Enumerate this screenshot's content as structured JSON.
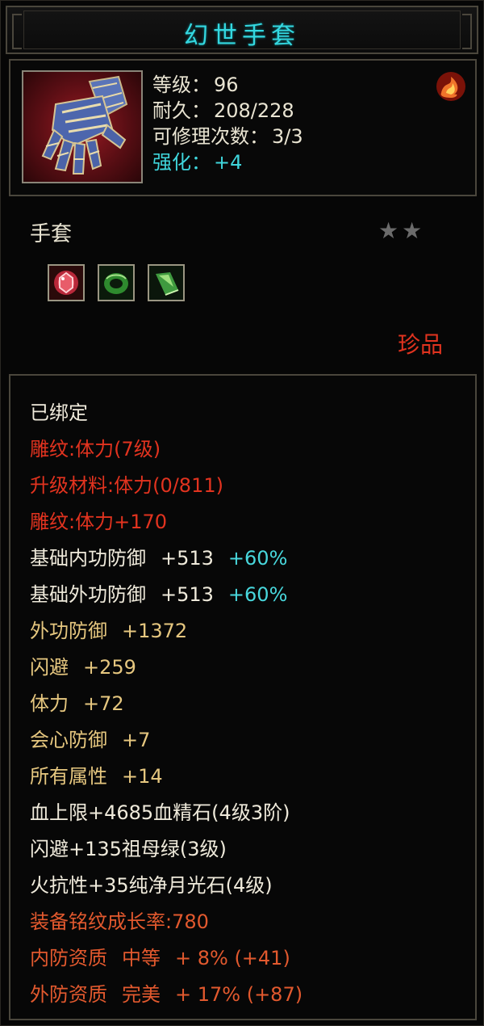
{
  "item": {
    "name": "幻世手套",
    "stats": {
      "level_label": "等级：",
      "level_value": "96",
      "durability_label": "耐久：",
      "durability_value": "208/228",
      "repair_label": "可修理次数：",
      "repair_value": "3/3",
      "enhance_label": "强化：",
      "enhance_value": "+4"
    },
    "type": "手套",
    "stars": "★★",
    "rarity": "珍品",
    "gems": [
      "ruby-gem-icon",
      "jade-ring-gem-icon",
      "green-crystal-gem-icon"
    ]
  },
  "properties": {
    "bound": "已绑定",
    "engrave1": "雕纹:体力(7级)",
    "upgrade_material": "升级材料:体力(0/811)",
    "engrave2": "雕纹:体力+170",
    "base_inner_def_label": "基础内功防御",
    "base_inner_def_value": "+513",
    "base_inner_def_pct": "+60%",
    "base_outer_def_label": "基础外功防御",
    "base_outer_def_value": "+513",
    "base_outer_def_pct": "+60%",
    "outer_def_label": "外功防御",
    "outer_def_value": "+1372",
    "dodge_label": "闪避",
    "dodge_value": "+259",
    "stamina_label": "体力",
    "stamina_value": "+72",
    "crit_def_label": "会心防御",
    "crit_def_value": "+7",
    "all_attr_label": "所有属性",
    "all_attr_value": "+14",
    "gem1": "血上限+4685血精石(4级3阶)",
    "gem2": "闪避+135祖母绿(3级)",
    "gem3": "火抗性+35纯净月光石(4级)",
    "growth": "装备铭纹成长率:780",
    "inner_quality_label": "内防资质",
    "inner_quality_grade": "中等",
    "inner_quality_value": "+ 8% (+41)",
    "outer_quality_label": "外防资质",
    "outer_quality_grade": "完美",
    "outer_quality_value": "+ 17% (+87)"
  },
  "colors": {
    "title": "#34d8e0",
    "red": "#e2331f",
    "gold": "#e6c77f",
    "cyan": "#48d7dc",
    "orange": "#e2592e"
  }
}
